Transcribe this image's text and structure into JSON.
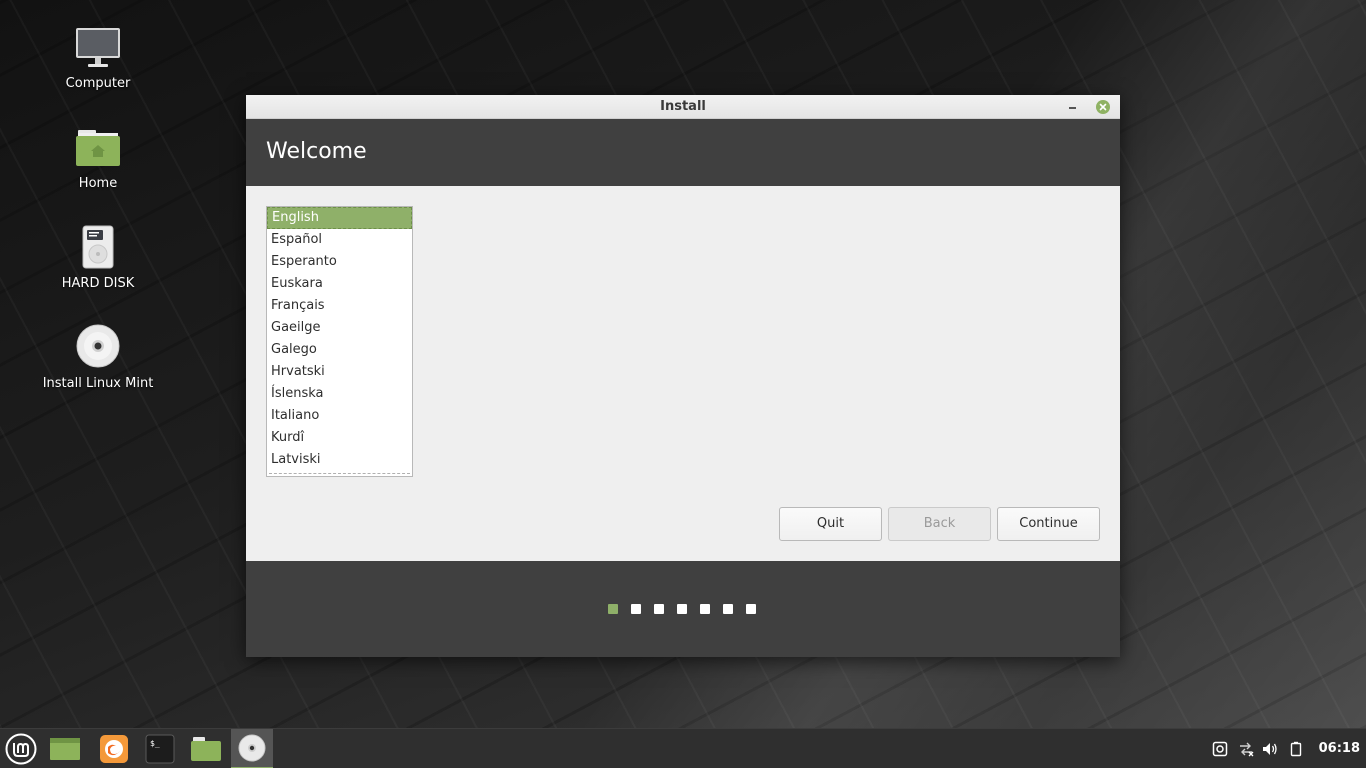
{
  "desktop": {
    "icons": [
      {
        "label": "Computer"
      },
      {
        "label": "Home"
      },
      {
        "label": "HARD DISK"
      },
      {
        "label": "Install Linux Mint"
      }
    ]
  },
  "window": {
    "title": "Install",
    "heading": "Welcome",
    "languages": [
      "English",
      "Español",
      "Esperanto",
      "Euskara",
      "Français",
      "Gaeilge",
      "Galego",
      "Hrvatski",
      "Íslenska",
      "Italiano",
      "Kurdî",
      "Latviski"
    ],
    "selected_language": "English",
    "buttons": {
      "quit": "Quit",
      "back": "Back",
      "continue": "Continue"
    },
    "progress": {
      "total_steps": 7,
      "current_step": 1
    }
  },
  "taskbar": {
    "clock": "06:18"
  },
  "colors": {
    "accent": "#8fb069",
    "header_band": "#404040",
    "panel": "#2f2f2f"
  }
}
